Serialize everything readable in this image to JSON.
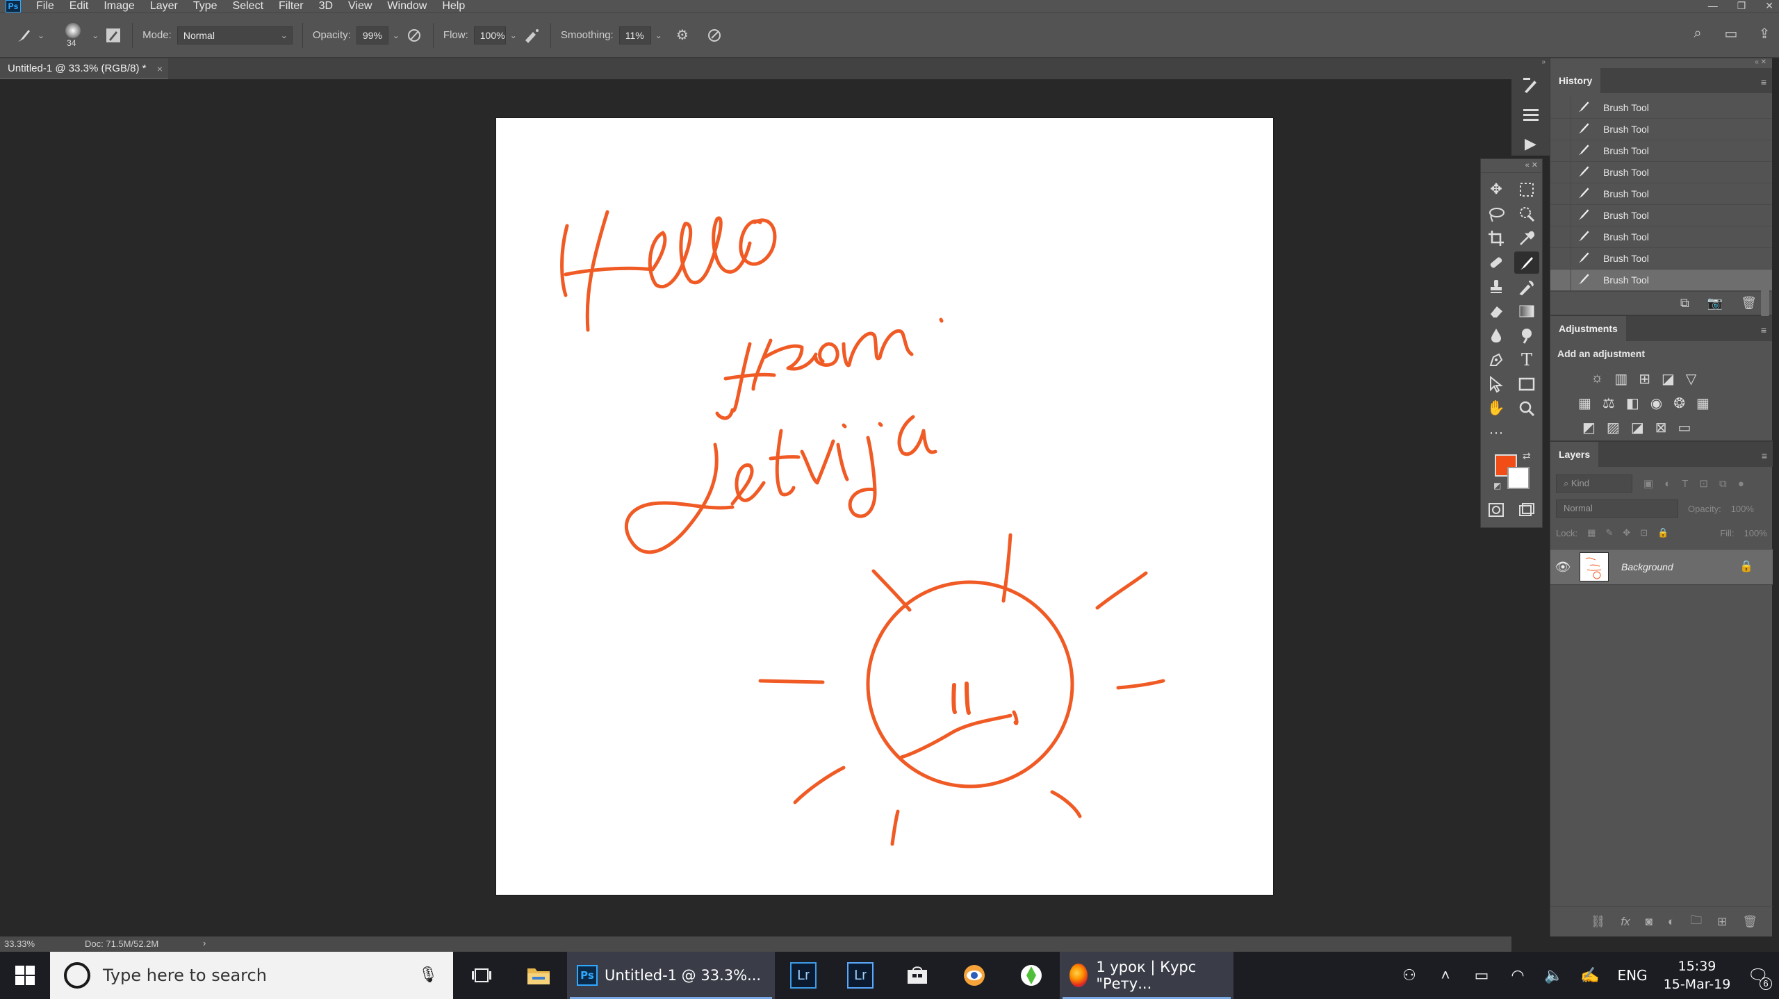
{
  "app": {
    "logo_text": "Ps",
    "menu": [
      "File",
      "Edit",
      "Image",
      "Layer",
      "Type",
      "Select",
      "Filter",
      "3D",
      "View",
      "Window",
      "Help"
    ]
  },
  "options": {
    "brush_size": "34",
    "mode_label": "Mode:",
    "mode_value": "Normal",
    "opacity_label": "Opacity:",
    "opacity_value": "99%",
    "flow_label": "Flow:",
    "flow_value": "100%",
    "smoothing_label": "Smoothing:",
    "smoothing_value": "11%"
  },
  "document": {
    "tab_title": "Untitled-1 @ 33.3% (RGB/8) *",
    "tab_close": "×",
    "canvas_text": "Hello from Latvija"
  },
  "status": {
    "zoom": "33.33%",
    "doc_size": "Doc: 71.5M/52.2M",
    "arrow": "›"
  },
  "history": {
    "title": "History",
    "items": [
      "Brush Tool",
      "Brush Tool",
      "Brush Tool",
      "Brush Tool",
      "Brush Tool",
      "Brush Tool",
      "Brush Tool",
      "Brush Tool",
      "Brush Tool"
    ],
    "selected_index": 8
  },
  "adjustments": {
    "title": "Adjustments",
    "subtitle": "Add an adjustment"
  },
  "layers": {
    "title": "Layers",
    "filter_placeholder": "Kind",
    "blend_mode": "Normal",
    "opacity_label": "Opacity:",
    "opacity_value": "100%",
    "lock_label": "Lock:",
    "fill_label": "Fill:",
    "fill_value": "100%",
    "items": [
      {
        "name": "Background",
        "visible": true,
        "locked": true
      }
    ]
  },
  "colors": {
    "foreground": "#f24c17",
    "background": "#ffffff",
    "brush_stroke": "#f05a24"
  },
  "taskbar": {
    "search_placeholder": "Type here to search",
    "apps": [
      {
        "name": "photoshop",
        "label": "Untitled-1 @ 33.3%...",
        "active": true
      },
      {
        "name": "lightroom-1",
        "label": "Lr"
      },
      {
        "name": "lightroom-2",
        "label": "Lr"
      },
      {
        "name": "firefox",
        "label": "1 урок | Курс \"Рету...",
        "active": true
      }
    ],
    "lang": "ENG",
    "time": "15:39",
    "date": "15-Mar-19",
    "notifications": "6"
  }
}
